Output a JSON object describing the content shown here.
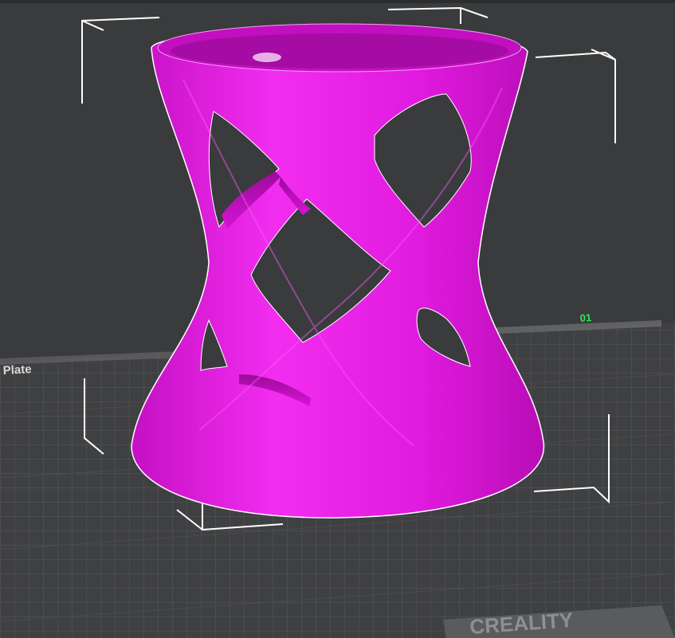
{
  "viewport": {
    "plate_number": "01",
    "plate_label": "Plate",
    "bed_brand": "CREALITY",
    "colors": {
      "background": "#3a3b3c",
      "model": "#e21be0",
      "plate_number": "#2ee65f",
      "bounding_box": "#ffffff",
      "grid": "#5a5b5c",
      "bed": "#404142"
    }
  }
}
